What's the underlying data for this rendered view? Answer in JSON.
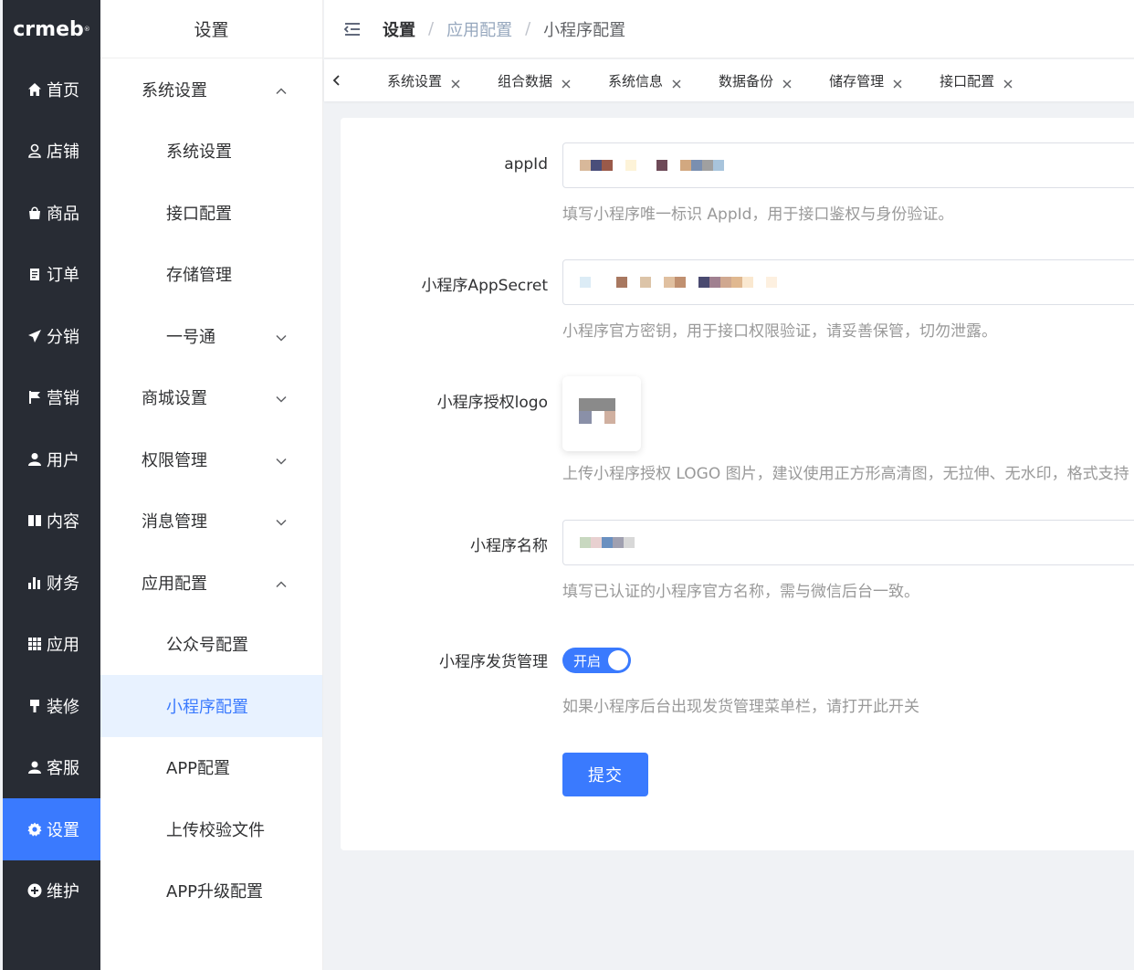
{
  "brand": {
    "logo_text": "crmeb",
    "logo_mark": "®"
  },
  "main_nav": [
    {
      "label": "首页",
      "icon": "home-icon"
    },
    {
      "label": "店铺",
      "icon": "store-icon"
    },
    {
      "label": "商品",
      "icon": "bag-icon"
    },
    {
      "label": "订单",
      "icon": "order-icon"
    },
    {
      "label": "分销",
      "icon": "send-icon"
    },
    {
      "label": "营销",
      "icon": "flag-icon"
    },
    {
      "label": "用户",
      "icon": "user-icon"
    },
    {
      "label": "内容",
      "icon": "book-icon"
    },
    {
      "label": "财务",
      "icon": "bar-chart-icon"
    },
    {
      "label": "应用",
      "icon": "grid-icon"
    },
    {
      "label": "装修",
      "icon": "brush-icon"
    },
    {
      "label": "客服",
      "icon": "service-icon"
    },
    {
      "label": "设置",
      "icon": "gear-icon",
      "active": true
    },
    {
      "label": "维护",
      "icon": "plus-circle-icon"
    }
  ],
  "sub_menu": {
    "title": "设置",
    "items": [
      {
        "label": "系统设置",
        "level": 1,
        "chevron": "up"
      },
      {
        "label": "系统设置",
        "level": 2
      },
      {
        "label": "接口配置",
        "level": 2
      },
      {
        "label": "存储管理",
        "level": 2
      },
      {
        "label": "一号通",
        "level": 2,
        "chevron": "down"
      },
      {
        "label": "商城设置",
        "level": 1,
        "chevron": "down"
      },
      {
        "label": "权限管理",
        "level": 1,
        "chevron": "down"
      },
      {
        "label": "消息管理",
        "level": 1,
        "chevron": "down"
      },
      {
        "label": "应用配置",
        "level": 1,
        "chevron": "up"
      },
      {
        "label": "公众号配置",
        "level": 2
      },
      {
        "label": "小程序配置",
        "level": 2,
        "active": true
      },
      {
        "label": "APP配置",
        "level": 2
      },
      {
        "label": "上传校验文件",
        "level": 2
      },
      {
        "label": "APP升级配置",
        "level": 2
      }
    ]
  },
  "header": {
    "breadcrumb": [
      "设置",
      "应用配置",
      "小程序配置"
    ],
    "separator": "/"
  },
  "tabs": [
    "系统设置",
    "组合数据",
    "系统信息",
    "数据备份",
    "储存管理",
    "接口配置"
  ],
  "form": {
    "appid": {
      "label": "appId",
      "help": "填写小程序唯一标识 AppId，用于接口鉴权与身份验证。"
    },
    "appsecret": {
      "label": "小程序AppSecret",
      "help": "小程序官方密钥，用于接口权限验证，请妥善保管，切勿泄露。"
    },
    "logo": {
      "label": "小程序授权logo",
      "help": "上传小程序授权 LOGO 图片，建议使用正方形高清图，无拉伸、无水印，格式支持"
    },
    "name": {
      "label": "小程序名称",
      "help": "填写已认证的小程序官方名称，需与微信后台一致。"
    },
    "delivery": {
      "label": "小程序发货管理",
      "switch_text": "开启",
      "switch_on": true,
      "help": "如果小程序后台出现发货管理菜单栏，请打开此开关"
    },
    "submit_label": "提交"
  },
  "colors": {
    "accent": "#3a7afe",
    "sidebar": "#282c34",
    "active_bg": "#e8f2ff"
  }
}
